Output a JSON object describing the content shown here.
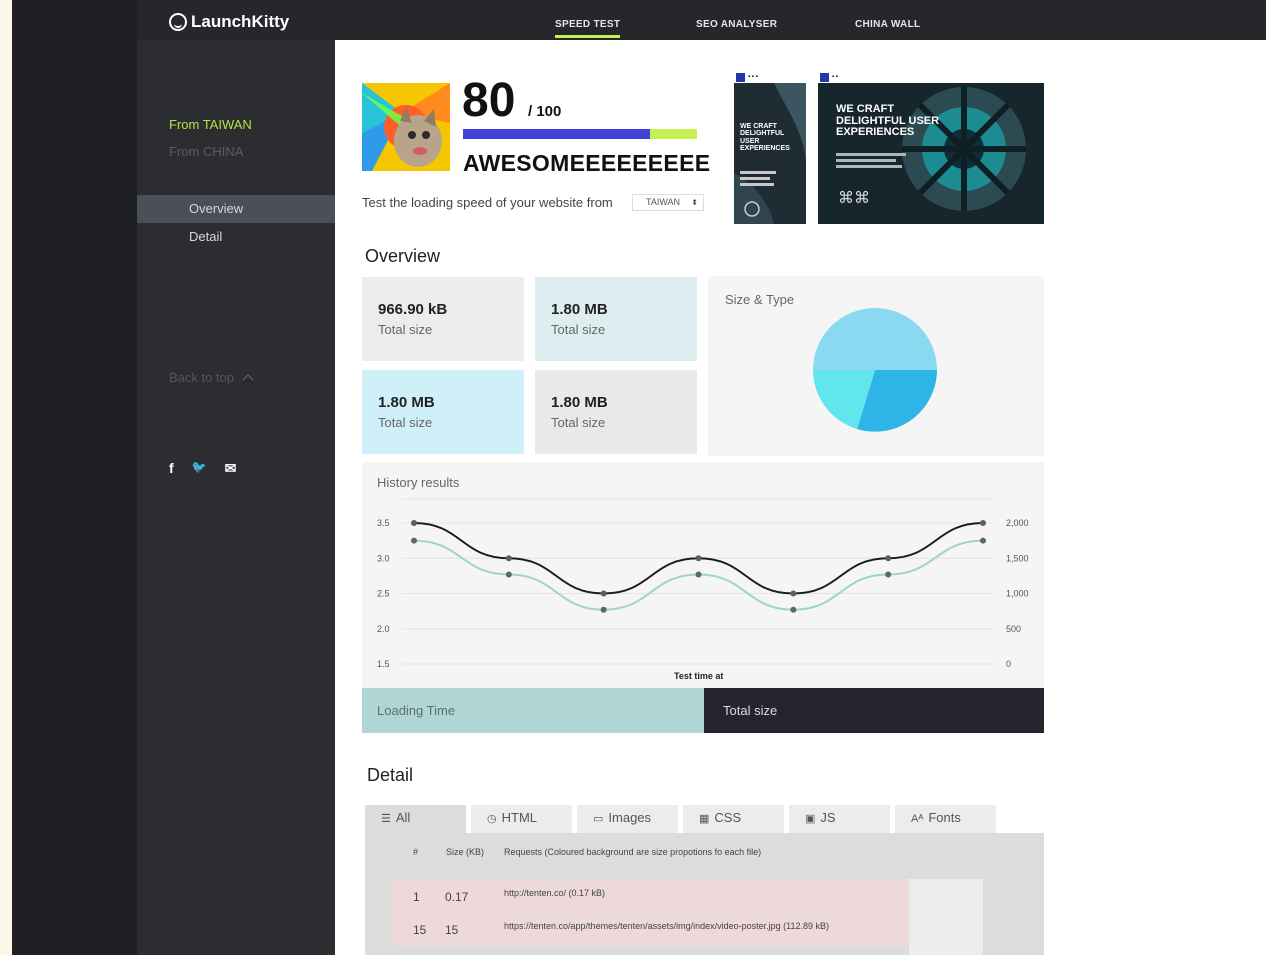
{
  "brand": {
    "name": "LaunchKitty"
  },
  "nav": [
    {
      "label": "SPEED TEST",
      "active": true
    },
    {
      "label": "SEO ANALYSER",
      "active": false
    },
    {
      "label": "CHINA WALL",
      "active": false
    }
  ],
  "sidebar": {
    "from_taiwan": "From TAIWAN",
    "from_china": "From CHINA",
    "items": [
      {
        "label": "Overview",
        "active": true
      },
      {
        "label": "Detail",
        "active": false
      }
    ],
    "back_to_top": "Back to top",
    "social": {
      "facebook": "f",
      "twitter": "🐦",
      "email": "✉"
    }
  },
  "score": {
    "value": "80",
    "out_of": "/ 100",
    "bar_fraction": 0.8,
    "verdict": "AWESOMEEEEEEEEE"
  },
  "test_location": {
    "prompt": "Test the loading speed of your website from",
    "selected": "TAIWAN"
  },
  "screenshots": {
    "mobile_text": "WE CRAFT DELIGHTFUL USER EXPERIENCES",
    "desktop_text": "WE CRAFT DELIGHTFUL USER EXPERIENCES"
  },
  "overview": {
    "title": "Overview",
    "stats": [
      {
        "value": "966.90 kB",
        "label": "Total size"
      },
      {
        "value": "1.80 MB",
        "label": "Total size"
      },
      {
        "value": "1.80 MB",
        "label": "Total size"
      },
      {
        "value": "1.80 MB",
        "label": "Total size"
      }
    ],
    "pie_title": "Size & Type"
  },
  "chart_data": {
    "type": "line",
    "title": "History results",
    "xlabel": "Test time at",
    "y_left_ticks": [
      "3.5",
      "3.0",
      "2.5",
      "2.0",
      "1.5"
    ],
    "y_right_ticks": [
      "2,000",
      "1,500",
      "1,000",
      "500",
      "0"
    ],
    "ylim_left": [
      1.5,
      3.5
    ],
    "ylim_right": [
      0,
      2000
    ],
    "series": [
      {
        "name": "Total size",
        "axis": "left",
        "values": [
          3.5,
          3.0,
          2.5,
          3.0,
          2.5,
          3.0,
          3.5
        ]
      },
      {
        "name": "Loading Time",
        "axis": "left",
        "values": [
          3.25,
          2.77,
          2.27,
          2.77,
          2.27,
          2.77,
          3.25
        ]
      }
    ],
    "grid": true
  },
  "legend": {
    "loading_time": "Loading Time",
    "total_size": "Total size"
  },
  "detail": {
    "title": "Detail",
    "tabs": [
      {
        "label": "All",
        "icon": "list-icon",
        "active": true
      },
      {
        "label": "HTML",
        "icon": "clock-icon",
        "active": false
      },
      {
        "label": "Images",
        "icon": "image-icon",
        "active": false
      },
      {
        "label": "CSS",
        "icon": "css-icon",
        "active": false
      },
      {
        "label": "JS",
        "icon": "js-icon",
        "active": false
      },
      {
        "label": "Fonts",
        "icon": "font-icon",
        "active": false
      }
    ],
    "columns": [
      "#",
      "Size (KB)",
      "Requests (Coloured background are size propotions fo each file)"
    ],
    "rows": [
      {
        "num": "1",
        "size": "0.17",
        "request": "http://tenten.co/ (0.17 kB)"
      },
      {
        "num": "15",
        "size": "15",
        "request": "https://tenten.co/app/themes/tenten/assets/img/index/video-poster.jpg (112.89 kB)"
      }
    ]
  },
  "colors": {
    "accent": "#c6f051",
    "score_bar": "#3f42d4",
    "pie_light": "#8bd9f0",
    "pie_cyan": "#61e6ee",
    "pie_blue": "#2fb4e8",
    "line_dark": "#1c1c1c",
    "line_light": "#9ed4cc"
  }
}
